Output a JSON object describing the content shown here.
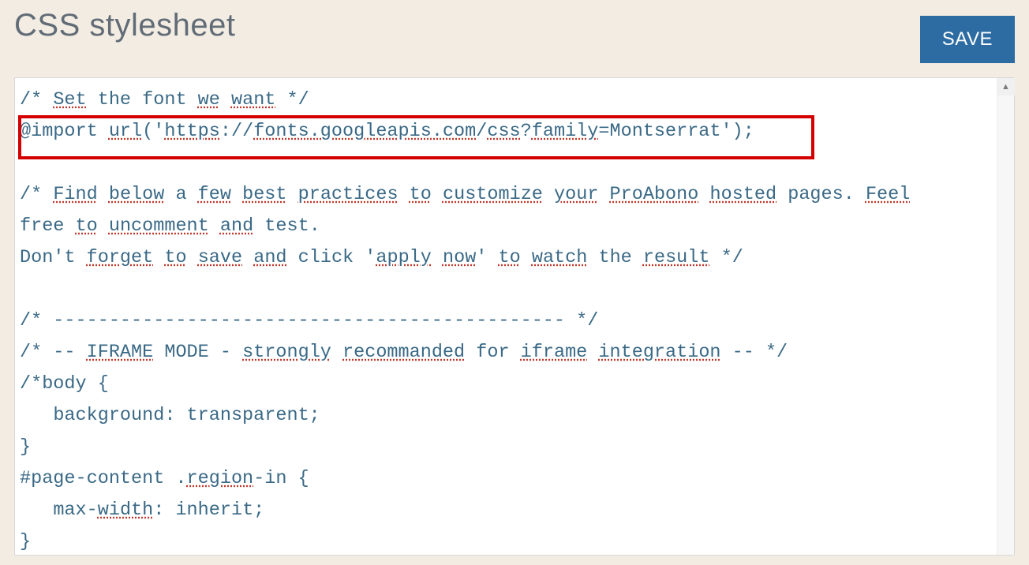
{
  "header": {
    "title": "CSS stylesheet",
    "save_label": "SAVE"
  },
  "code": {
    "line1_a": "/* ",
    "line1_b": "Set",
    "line1_c": " the font ",
    "line1_d": "we",
    "line1_e": " ",
    "line1_f": "want",
    "line1_g": " */",
    "line2_a": "@import ",
    "line2_b": "url",
    "line2_c": "('",
    "line2_d": "https",
    "line2_e": "://",
    "line2_f": "fonts.googleapis.com",
    "line2_g": "/",
    "line2_h": "css",
    "line2_i": "?",
    "line2_j": "family",
    "line2_k": "=Montserrat');",
    "line4_a": "/* ",
    "line4_b": "Find",
    "line4_c": " ",
    "line4_d": "below",
    "line4_e": " a ",
    "line4_f": "few",
    "line4_g": " ",
    "line4_h": "best",
    "line4_i": " ",
    "line4_j": "practices",
    "line4_k": " ",
    "line4_l": "to",
    "line4_m": " ",
    "line4_n": "customize",
    "line4_o": " ",
    "line4_p": "your",
    "line4_q": " ",
    "line4_r": "ProAbono",
    "line4_s": " ",
    "line4_t": "hosted",
    "line4_u": " pages. ",
    "line4_v": "Feel",
    "line5_a": "free ",
    "line5_b": "to",
    "line5_c": " ",
    "line5_d": "uncomment",
    "line5_e": " ",
    "line5_f": "and",
    "line5_g": " test.",
    "line6_a": "Don't ",
    "line6_b": "forget",
    "line6_c": " ",
    "line6_d": "to",
    "line6_e": " ",
    "line6_f": "save",
    "line6_g": " ",
    "line6_h": "and",
    "line6_i": " click '",
    "line6_j": "apply",
    "line6_k": " ",
    "line6_l": "now",
    "line6_m": "' ",
    "line6_n": "to",
    "line6_o": " ",
    "line6_p": "watch",
    "line6_q": " the ",
    "line6_r": "result",
    "line6_s": " */",
    "line8": "/* ---------------------------------------------- */",
    "line9_a": "/* -- ",
    "line9_b": "IFRAME",
    "line9_c": " MODE - ",
    "line9_d": "strongly",
    "line9_e": " ",
    "line9_f": "recommanded",
    "line9_g": " for ",
    "line9_h": "iframe",
    "line9_i": " ",
    "line9_j": "integration",
    "line9_k": " -- */",
    "line10": "/*body {",
    "line11": "   background: transparent;",
    "line12": "}",
    "line13_a": "#page-content .",
    "line13_b": "region",
    "line13_c": "-in {",
    "line14_a": "   max-",
    "line14_b": "width",
    "line14_c": ": inherit;",
    "line15": "}"
  },
  "scroll": {
    "up_glyph": "▲"
  }
}
